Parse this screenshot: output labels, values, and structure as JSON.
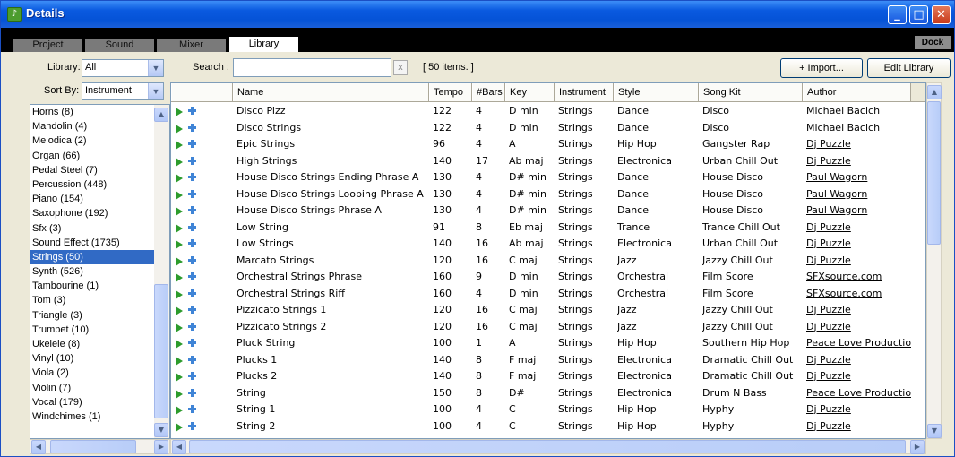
{
  "window": {
    "title": "Details",
    "app_icon": "app-logo-icon",
    "minimize": "_",
    "maximize": "□",
    "close": "✕"
  },
  "tabs": [
    "Project",
    "Sound",
    "Mixer",
    "Library"
  ],
  "dock_label": "Dock",
  "filters": {
    "library_label": "Library:",
    "library_value": "All",
    "sortby_label": "Sort By:",
    "sortby_value": "Instrument",
    "search_label": "Search :",
    "search_value": "",
    "clear_label": "x",
    "items_count": "[ 50 items. ]"
  },
  "buttons": {
    "import": "+ Import...",
    "edit_library": "Edit Library"
  },
  "categories": [
    "Horns  (8)",
    "Mandolin  (4)",
    "Melodica  (2)",
    "Organ  (66)",
    "Pedal Steel  (7)",
    "Percussion  (448)",
    "Piano  (154)",
    "Saxophone  (192)",
    "Sfx  (3)",
    "Sound Effect  (1735)",
    "Strings  (50)",
    "Synth  (526)",
    "Tambourine  (1)",
    "Tom  (3)",
    "Triangle  (3)",
    "Trumpet  (10)",
    "Ukelele  (8)",
    "Vinyl  (10)",
    "Viola  (2)",
    "Violin  (7)",
    "Vocal  (179)",
    "Windchimes  (1)"
  ],
  "selected_category_index": 10,
  "columns": [
    "Name",
    "Tempo",
    "#Bars",
    "Key",
    "Instrument",
    "Style",
    "Song Kit",
    "Author"
  ],
  "rows": [
    [
      "Disco Pizz",
      "122",
      "4",
      "D min",
      "Strings",
      "Dance",
      "Disco",
      "Michael Bacich"
    ],
    [
      "Disco Strings",
      "122",
      "4",
      "D min",
      "Strings",
      "Dance",
      "Disco",
      "Michael Bacich"
    ],
    [
      "Epic Strings",
      "96",
      "4",
      "A",
      "Strings",
      "Hip Hop",
      "Gangster Rap",
      "Dj Puzzle"
    ],
    [
      "High Strings",
      "140",
      "17",
      "Ab maj",
      "Strings",
      "Electronica",
      "Urban Chill Out",
      "Dj Puzzle"
    ],
    [
      "House Disco Strings Ending Phrase A",
      "130",
      "4",
      "D# min",
      "Strings",
      "Dance",
      "House Disco",
      "Paul Wagorn"
    ],
    [
      "House Disco Strings Looping Phrase A",
      "130",
      "4",
      "D# min",
      "Strings",
      "Dance",
      "House Disco",
      "Paul Wagorn"
    ],
    [
      "House Disco Strings Phrase A",
      "130",
      "4",
      "D# min",
      "Strings",
      "Dance",
      "House Disco",
      "Paul Wagorn"
    ],
    [
      "Low String",
      "91",
      "8",
      "Eb maj",
      "Strings",
      "Trance",
      "Trance Chill Out",
      "Dj Puzzle"
    ],
    [
      "Low Strings",
      "140",
      "16",
      "Ab maj",
      "Strings",
      "Electronica",
      "Urban Chill Out",
      "Dj Puzzle"
    ],
    [
      "Marcato Strings",
      "120",
      "16",
      "C maj",
      "Strings",
      "Jazz",
      "Jazzy Chill Out",
      "Dj Puzzle"
    ],
    [
      "Orchestral Strings Phrase",
      "160",
      "9",
      "D min",
      "Strings",
      "Orchestral",
      "Film Score",
      "SFXsource.com"
    ],
    [
      "Orchestral Strings Riff",
      "160",
      "4",
      "D min",
      "Strings",
      "Orchestral",
      "Film Score",
      "SFXsource.com"
    ],
    [
      "Pizzicato Strings 1",
      "120",
      "16",
      "C maj",
      "Strings",
      "Jazz",
      "Jazzy Chill Out",
      "Dj Puzzle"
    ],
    [
      "Pizzicato Strings 2",
      "120",
      "16",
      "C maj",
      "Strings",
      "Jazz",
      "Jazzy Chill Out",
      "Dj Puzzle"
    ],
    [
      "Pluck String",
      "100",
      "1",
      "A",
      "Strings",
      "Hip Hop",
      "Southern Hip Hop",
      "Peace Love Productions"
    ],
    [
      "Plucks 1",
      "140",
      "8",
      "F maj",
      "Strings",
      "Electronica",
      "Dramatic Chill Out",
      "Dj Puzzle"
    ],
    [
      "Plucks 2",
      "140",
      "8",
      "F maj",
      "Strings",
      "Electronica",
      "Dramatic Chill Out",
      "Dj Puzzle"
    ],
    [
      "String",
      "150",
      "8",
      "D#",
      "Strings",
      "Electronica",
      "Drum N Bass",
      "Peace Love Productions"
    ],
    [
      "String 1",
      "100",
      "4",
      "C",
      "Strings",
      "Hip Hop",
      "Hyphy",
      "Dj Puzzle"
    ],
    [
      "String 2",
      "100",
      "4",
      "C",
      "Strings",
      "Hip Hop",
      "Hyphy",
      "Dj Puzzle"
    ]
  ],
  "linked_authors": [
    "Dj Puzzle",
    "Paul Wagorn",
    "SFXsource.com",
    "Peace Love Productions"
  ],
  "row_icons": [
    "play-icon",
    "add-icon"
  ],
  "colors": {
    "titlebar": "#0553d7",
    "selection": "#316ac5",
    "play": "#2c9b2c",
    "add": "#3f84d6"
  }
}
